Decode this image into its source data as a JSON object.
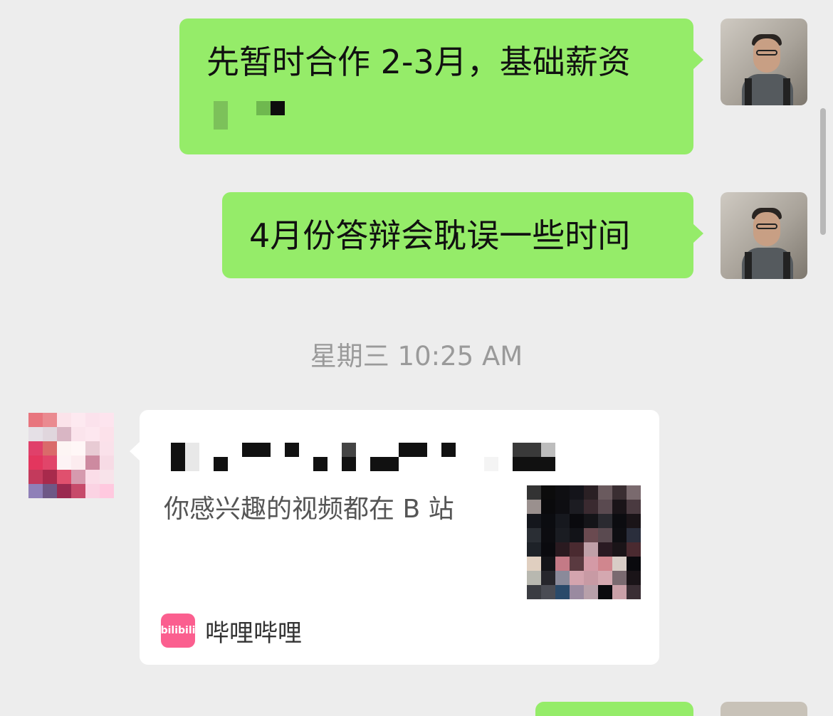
{
  "chat": {
    "messages_out": [
      {
        "text": "先暂时合作 2-3月，基础薪资"
      },
      {
        "text": "4月份答辩会耽误一些时间"
      }
    ],
    "timestamp": "星期三 10:25 AM",
    "card": {
      "description": "你感兴趣的视频都在 B 站",
      "source_name": "哔哩哔哩",
      "source_icon_text": "bilibili",
      "source_icon_name": "bilibili-logo-icon"
    }
  },
  "colors": {
    "background": "#ededed",
    "bubble_out": "#95ec69",
    "card": "#ffffff",
    "timestamp": "#9a9a9a",
    "bilibili_pink": "#fb5f8f"
  }
}
